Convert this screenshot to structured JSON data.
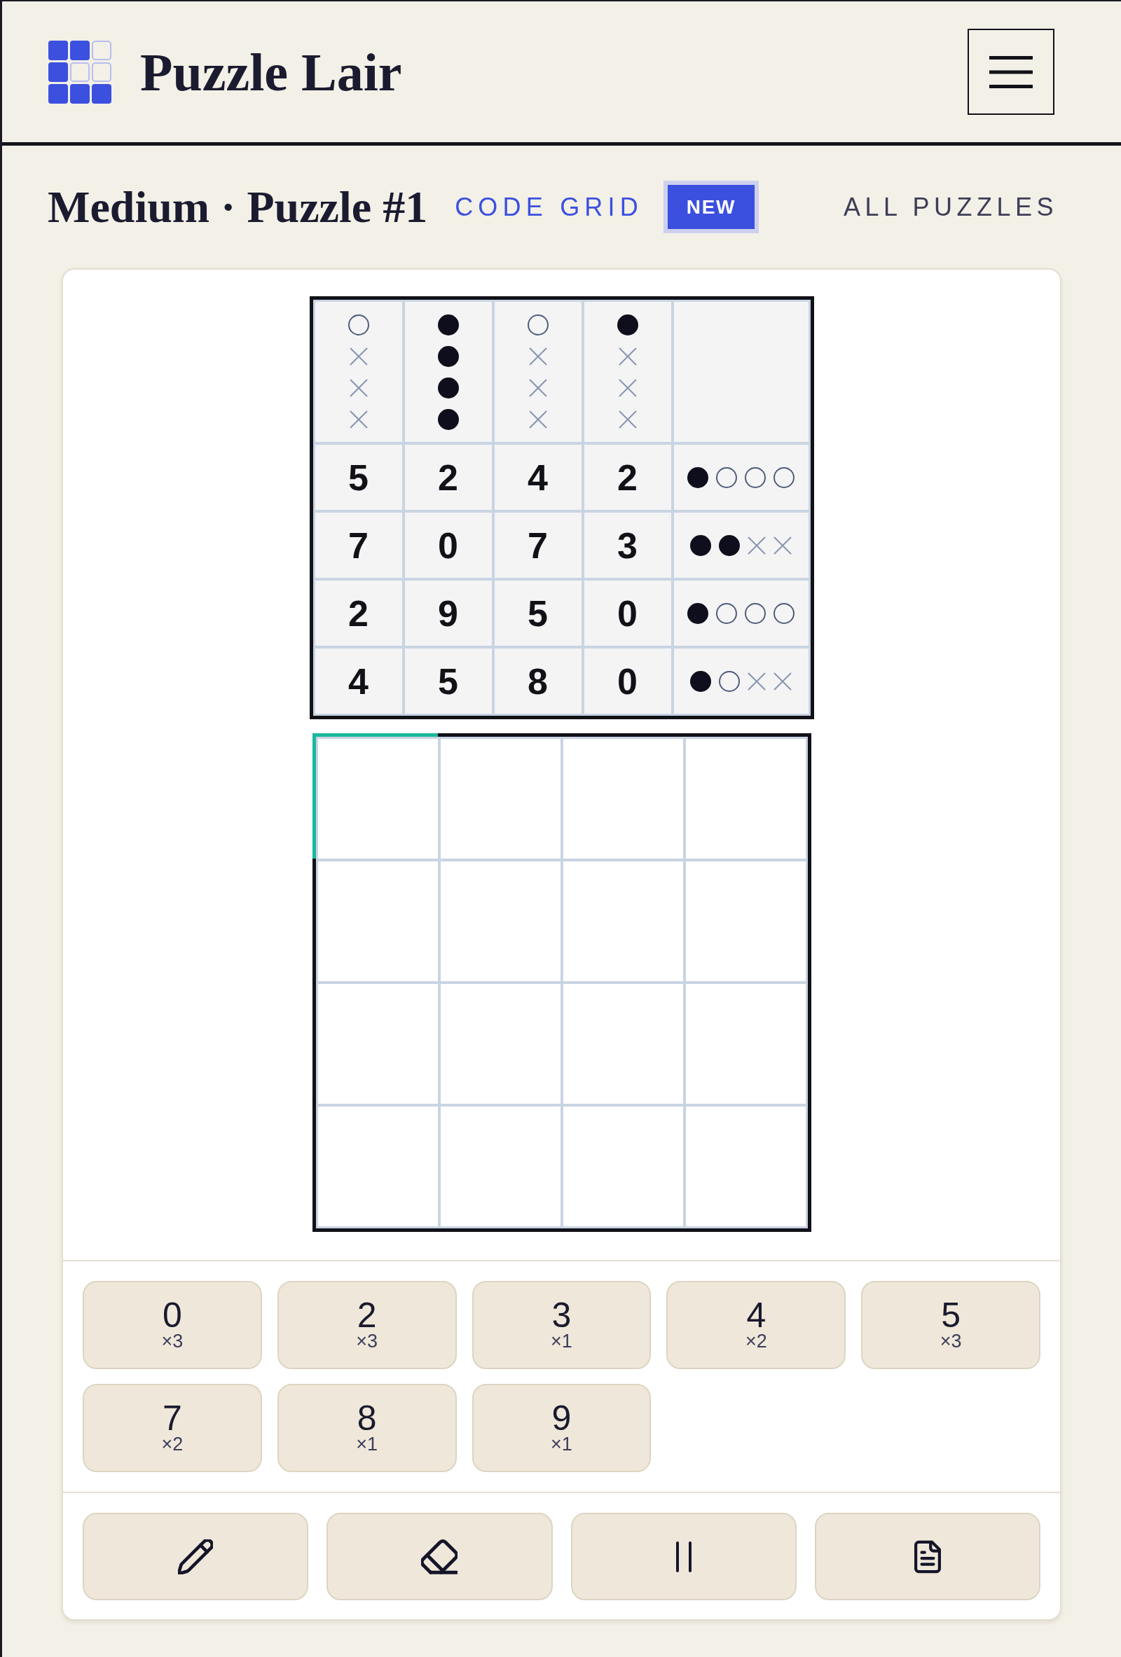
{
  "header": {
    "title": "Puzzle Lair"
  },
  "puzzle_bar": {
    "title": "Medium · Puzzle #1",
    "category": "CODE GRID",
    "badge": "NEW",
    "link": "ALL PUZZLES"
  },
  "clue_grid": {
    "column_marks": [
      [
        {
          "kind": "hollow"
        },
        {
          "kind": "cross"
        },
        {
          "kind": "cross"
        },
        {
          "kind": "cross"
        }
      ],
      [
        {
          "kind": "filled"
        },
        {
          "kind": "filled"
        },
        {
          "kind": "filled"
        },
        {
          "kind": "filled"
        }
      ],
      [
        {
          "kind": "hollow"
        },
        {
          "kind": "cross"
        },
        {
          "kind": "cross"
        },
        {
          "kind": "cross"
        }
      ],
      [
        {
          "kind": "filled"
        },
        {
          "kind": "cross"
        },
        {
          "kind": "cross"
        },
        {
          "kind": "cross"
        }
      ]
    ],
    "rows": [
      {
        "digits": [
          "5",
          "2",
          "4",
          "2"
        ],
        "marks": [
          {
            "kind": "filled"
          },
          {
            "kind": "hollow"
          },
          {
            "kind": "hollow"
          },
          {
            "kind": "hollow"
          }
        ]
      },
      {
        "digits": [
          "7",
          "0",
          "7",
          "3"
        ],
        "marks": [
          {
            "kind": "filled"
          },
          {
            "kind": "filled"
          },
          {
            "kind": "cross"
          },
          {
            "kind": "cross"
          }
        ]
      },
      {
        "digits": [
          "2",
          "9",
          "5",
          "0"
        ],
        "marks": [
          {
            "kind": "filled"
          },
          {
            "kind": "hollow"
          },
          {
            "kind": "hollow"
          },
          {
            "kind": "hollow"
          }
        ]
      },
      {
        "digits": [
          "4",
          "5",
          "8",
          "0"
        ],
        "marks": [
          {
            "kind": "filled"
          },
          {
            "kind": "hollow"
          },
          {
            "kind": "cross"
          },
          {
            "kind": "cross"
          }
        ]
      }
    ]
  },
  "answer_grid": {
    "rows": [
      [
        {
          "selected": true
        },
        {
          "selected": false
        },
        {
          "selected": false
        },
        {
          "selected": false
        }
      ],
      [
        {
          "selected": false
        },
        {
          "selected": false
        },
        {
          "selected": false
        },
        {
          "selected": false
        }
      ],
      [
        {
          "selected": false
        },
        {
          "selected": false
        },
        {
          "selected": false
        },
        {
          "selected": false
        }
      ],
      [
        {
          "selected": false
        },
        {
          "selected": false
        },
        {
          "selected": false
        },
        {
          "selected": false
        }
      ]
    ]
  },
  "keypad": [
    {
      "digit": "0",
      "count": "×3"
    },
    {
      "digit": "2",
      "count": "×3"
    },
    {
      "digit": "3",
      "count": "×1"
    },
    {
      "digit": "4",
      "count": "×2"
    },
    {
      "digit": "5",
      "count": "×3"
    },
    {
      "digit": "7",
      "count": "×2"
    },
    {
      "digit": "8",
      "count": "×1"
    },
    {
      "digit": "9",
      "count": "×1"
    }
  ],
  "tools": [
    {
      "kind": "pencil"
    },
    {
      "kind": "eraser"
    },
    {
      "kind": "pause"
    },
    {
      "kind": "notes"
    }
  ]
}
